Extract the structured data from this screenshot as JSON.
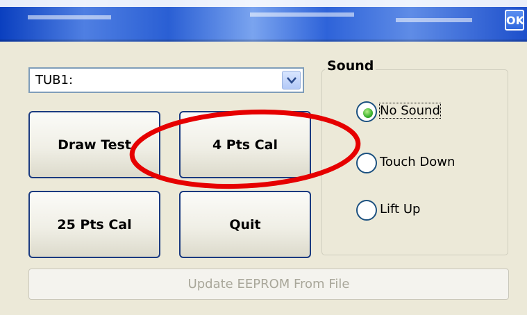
{
  "titlebar": {
    "ok_label": "OK"
  },
  "device_select": {
    "value": "TUB1:"
  },
  "buttons": {
    "draw_test": "Draw Test",
    "four_pts_cal": "4 Pts Cal",
    "twentyfive_pts_cal": "25 Pts Cal",
    "quit": "Quit",
    "update_eeprom": "Update EEPROM From File"
  },
  "sound_group": {
    "title": "Sound",
    "options": [
      {
        "label": "No Sound",
        "selected": true
      },
      {
        "label": "Touch Down",
        "selected": false
      },
      {
        "label": "Lift Up",
        "selected": false
      }
    ]
  },
  "annotation": {
    "color": "#e60000",
    "target": "4 Pts Cal"
  },
  "colors": {
    "titlebar_blue": "#2a5fd4",
    "dialog_bg": "#ece9d8",
    "button_border": "#1a3a80",
    "disabled_text": "#a9a79a"
  }
}
